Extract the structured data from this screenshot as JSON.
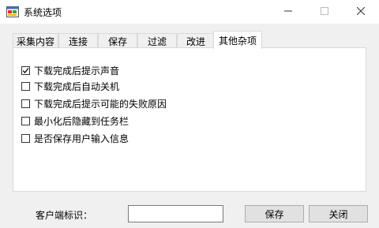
{
  "window": {
    "title": "系统选项",
    "icon": "app-window-icon"
  },
  "tabs": [
    {
      "label": "采集内容",
      "active": false
    },
    {
      "label": "连接",
      "active": false
    },
    {
      "label": "保存",
      "active": false
    },
    {
      "label": "过滤",
      "active": false
    },
    {
      "label": "改进",
      "active": false
    },
    {
      "label": "其他杂项",
      "active": true
    }
  ],
  "options": [
    {
      "label": "下载完成后提示声音",
      "checked": true
    },
    {
      "label": "下载完成后自动关机",
      "checked": false
    },
    {
      "label": "下载完成后提示可能的失败原因",
      "checked": false
    },
    {
      "label": "最小化后隐藏到任务栏",
      "checked": false
    },
    {
      "label": "是否保存用户输入信息",
      "checked": false
    }
  ],
  "footer": {
    "client_id_label": "客户端标识：",
    "client_id_value": "",
    "save_label": "保存",
    "close_label": "关闭"
  },
  "colors": {
    "client_bg": "#f0f0f0",
    "panel_bg": "#ffffff",
    "button_bg": "#e1e1e1"
  }
}
